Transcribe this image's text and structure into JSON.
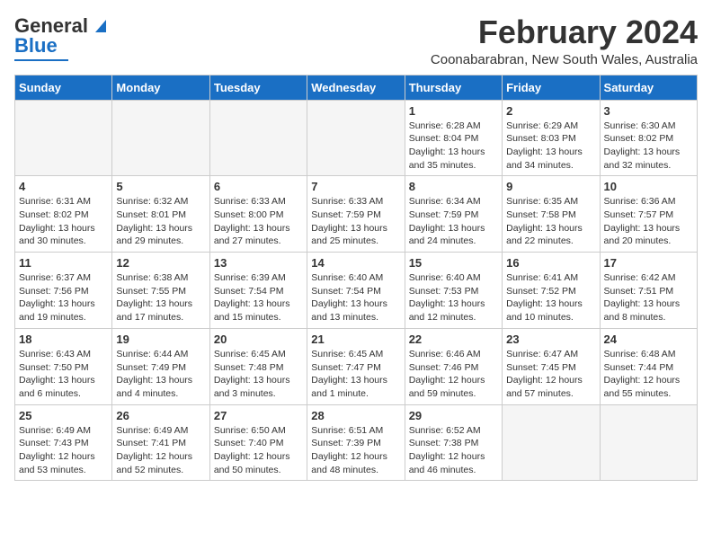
{
  "header": {
    "logo_general": "General",
    "logo_blue": "Blue",
    "month_title": "February 2024",
    "location": "Coonabarabran, New South Wales, Australia"
  },
  "weekdays": [
    "Sunday",
    "Monday",
    "Tuesday",
    "Wednesday",
    "Thursday",
    "Friday",
    "Saturday"
  ],
  "weeks": [
    [
      {
        "day": "",
        "info": ""
      },
      {
        "day": "",
        "info": ""
      },
      {
        "day": "",
        "info": ""
      },
      {
        "day": "",
        "info": ""
      },
      {
        "day": "1",
        "info": "Sunrise: 6:28 AM\nSunset: 8:04 PM\nDaylight: 13 hours\nand 35 minutes."
      },
      {
        "day": "2",
        "info": "Sunrise: 6:29 AM\nSunset: 8:03 PM\nDaylight: 13 hours\nand 34 minutes."
      },
      {
        "day": "3",
        "info": "Sunrise: 6:30 AM\nSunset: 8:02 PM\nDaylight: 13 hours\nand 32 minutes."
      }
    ],
    [
      {
        "day": "4",
        "info": "Sunrise: 6:31 AM\nSunset: 8:02 PM\nDaylight: 13 hours\nand 30 minutes."
      },
      {
        "day": "5",
        "info": "Sunrise: 6:32 AM\nSunset: 8:01 PM\nDaylight: 13 hours\nand 29 minutes."
      },
      {
        "day": "6",
        "info": "Sunrise: 6:33 AM\nSunset: 8:00 PM\nDaylight: 13 hours\nand 27 minutes."
      },
      {
        "day": "7",
        "info": "Sunrise: 6:33 AM\nSunset: 7:59 PM\nDaylight: 13 hours\nand 25 minutes."
      },
      {
        "day": "8",
        "info": "Sunrise: 6:34 AM\nSunset: 7:59 PM\nDaylight: 13 hours\nand 24 minutes."
      },
      {
        "day": "9",
        "info": "Sunrise: 6:35 AM\nSunset: 7:58 PM\nDaylight: 13 hours\nand 22 minutes."
      },
      {
        "day": "10",
        "info": "Sunrise: 6:36 AM\nSunset: 7:57 PM\nDaylight: 13 hours\nand 20 minutes."
      }
    ],
    [
      {
        "day": "11",
        "info": "Sunrise: 6:37 AM\nSunset: 7:56 PM\nDaylight: 13 hours\nand 19 minutes."
      },
      {
        "day": "12",
        "info": "Sunrise: 6:38 AM\nSunset: 7:55 PM\nDaylight: 13 hours\nand 17 minutes."
      },
      {
        "day": "13",
        "info": "Sunrise: 6:39 AM\nSunset: 7:54 PM\nDaylight: 13 hours\nand 15 minutes."
      },
      {
        "day": "14",
        "info": "Sunrise: 6:40 AM\nSunset: 7:54 PM\nDaylight: 13 hours\nand 13 minutes."
      },
      {
        "day": "15",
        "info": "Sunrise: 6:40 AM\nSunset: 7:53 PM\nDaylight: 13 hours\nand 12 minutes."
      },
      {
        "day": "16",
        "info": "Sunrise: 6:41 AM\nSunset: 7:52 PM\nDaylight: 13 hours\nand 10 minutes."
      },
      {
        "day": "17",
        "info": "Sunrise: 6:42 AM\nSunset: 7:51 PM\nDaylight: 13 hours\nand 8 minutes."
      }
    ],
    [
      {
        "day": "18",
        "info": "Sunrise: 6:43 AM\nSunset: 7:50 PM\nDaylight: 13 hours\nand 6 minutes."
      },
      {
        "day": "19",
        "info": "Sunrise: 6:44 AM\nSunset: 7:49 PM\nDaylight: 13 hours\nand 4 minutes."
      },
      {
        "day": "20",
        "info": "Sunrise: 6:45 AM\nSunset: 7:48 PM\nDaylight: 13 hours\nand 3 minutes."
      },
      {
        "day": "21",
        "info": "Sunrise: 6:45 AM\nSunset: 7:47 PM\nDaylight: 13 hours\nand 1 minute."
      },
      {
        "day": "22",
        "info": "Sunrise: 6:46 AM\nSunset: 7:46 PM\nDaylight: 12 hours\nand 59 minutes."
      },
      {
        "day": "23",
        "info": "Sunrise: 6:47 AM\nSunset: 7:45 PM\nDaylight: 12 hours\nand 57 minutes."
      },
      {
        "day": "24",
        "info": "Sunrise: 6:48 AM\nSunset: 7:44 PM\nDaylight: 12 hours\nand 55 minutes."
      }
    ],
    [
      {
        "day": "25",
        "info": "Sunrise: 6:49 AM\nSunset: 7:43 PM\nDaylight: 12 hours\nand 53 minutes."
      },
      {
        "day": "26",
        "info": "Sunrise: 6:49 AM\nSunset: 7:41 PM\nDaylight: 12 hours\nand 52 minutes."
      },
      {
        "day": "27",
        "info": "Sunrise: 6:50 AM\nSunset: 7:40 PM\nDaylight: 12 hours\nand 50 minutes."
      },
      {
        "day": "28",
        "info": "Sunrise: 6:51 AM\nSunset: 7:39 PM\nDaylight: 12 hours\nand 48 minutes."
      },
      {
        "day": "29",
        "info": "Sunrise: 6:52 AM\nSunset: 7:38 PM\nDaylight: 12 hours\nand 46 minutes."
      },
      {
        "day": "",
        "info": ""
      },
      {
        "day": "",
        "info": ""
      }
    ]
  ]
}
